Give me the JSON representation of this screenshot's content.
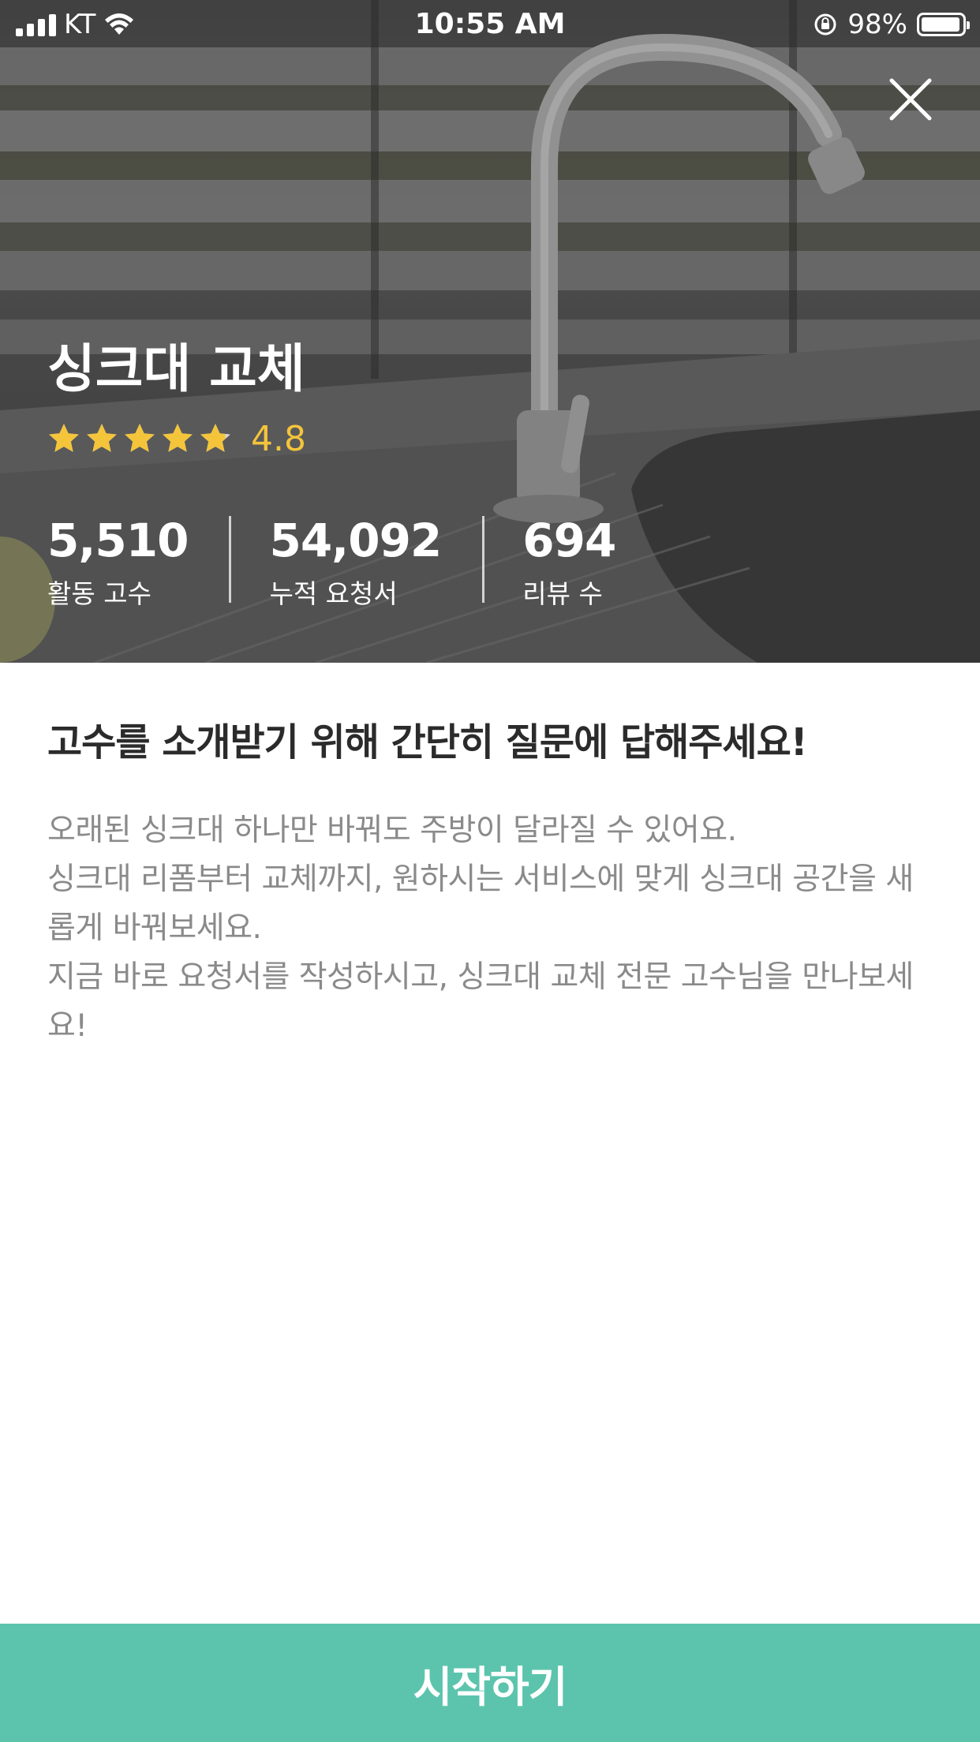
{
  "status_bar": {
    "carrier": "KT",
    "time": "10:55 AM",
    "battery": "98%",
    "battery_level": 0.98
  },
  "hero": {
    "title": "싱크대 교체",
    "rating_value": "4.8",
    "rating_stars": 4.8,
    "rating_max": 5,
    "stats": [
      {
        "value": "5,510",
        "label": "활동 고수"
      },
      {
        "value": "54,092",
        "label": "누적 요청서"
      },
      {
        "value": "694",
        "label": "리뷰 수"
      }
    ]
  },
  "content": {
    "heading": "고수를 소개받기 위해 간단히 질문에 답해주세요!",
    "lines": [
      "오래된 싱크대 하나만 바꿔도 주방이 달라질 수 있어요.",
      "싱크대 리폼부터 교체까지, 원하시는 서비스에 맞게 싱크대 공간을 새롭게 바꿔보세요.",
      "지금 바로 요청서를 작성하시고, 싱크대 교체 전문 고수님을 만나보세요!"
    ]
  },
  "cta": {
    "label": "시작하기"
  },
  "colors": {
    "accent": "#5cc4ad",
    "star": "#f4c43b",
    "star_empty": "#d9d9d9"
  }
}
